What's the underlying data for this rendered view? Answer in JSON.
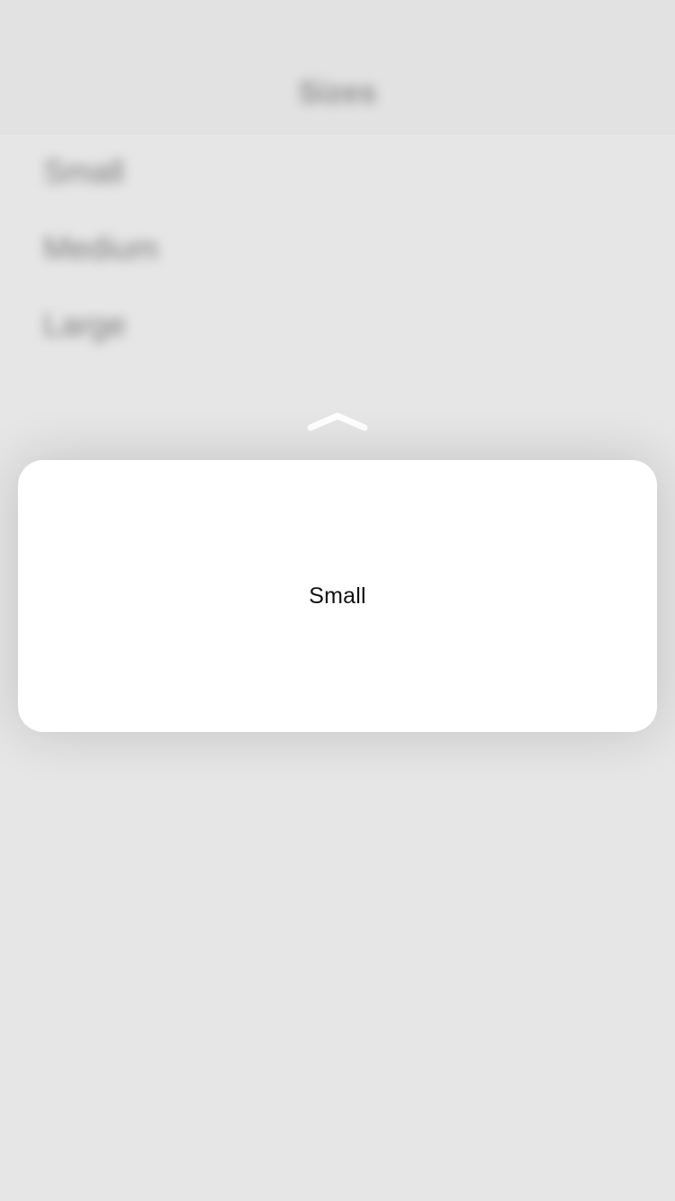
{
  "background": {
    "nav_title": "Sizes",
    "rows": [
      {
        "label": "Small"
      },
      {
        "label": "Medium"
      },
      {
        "label": "Large"
      }
    ]
  },
  "peek": {
    "indicator_icon": "chevron-up-icon",
    "preview_label": "Small"
  }
}
